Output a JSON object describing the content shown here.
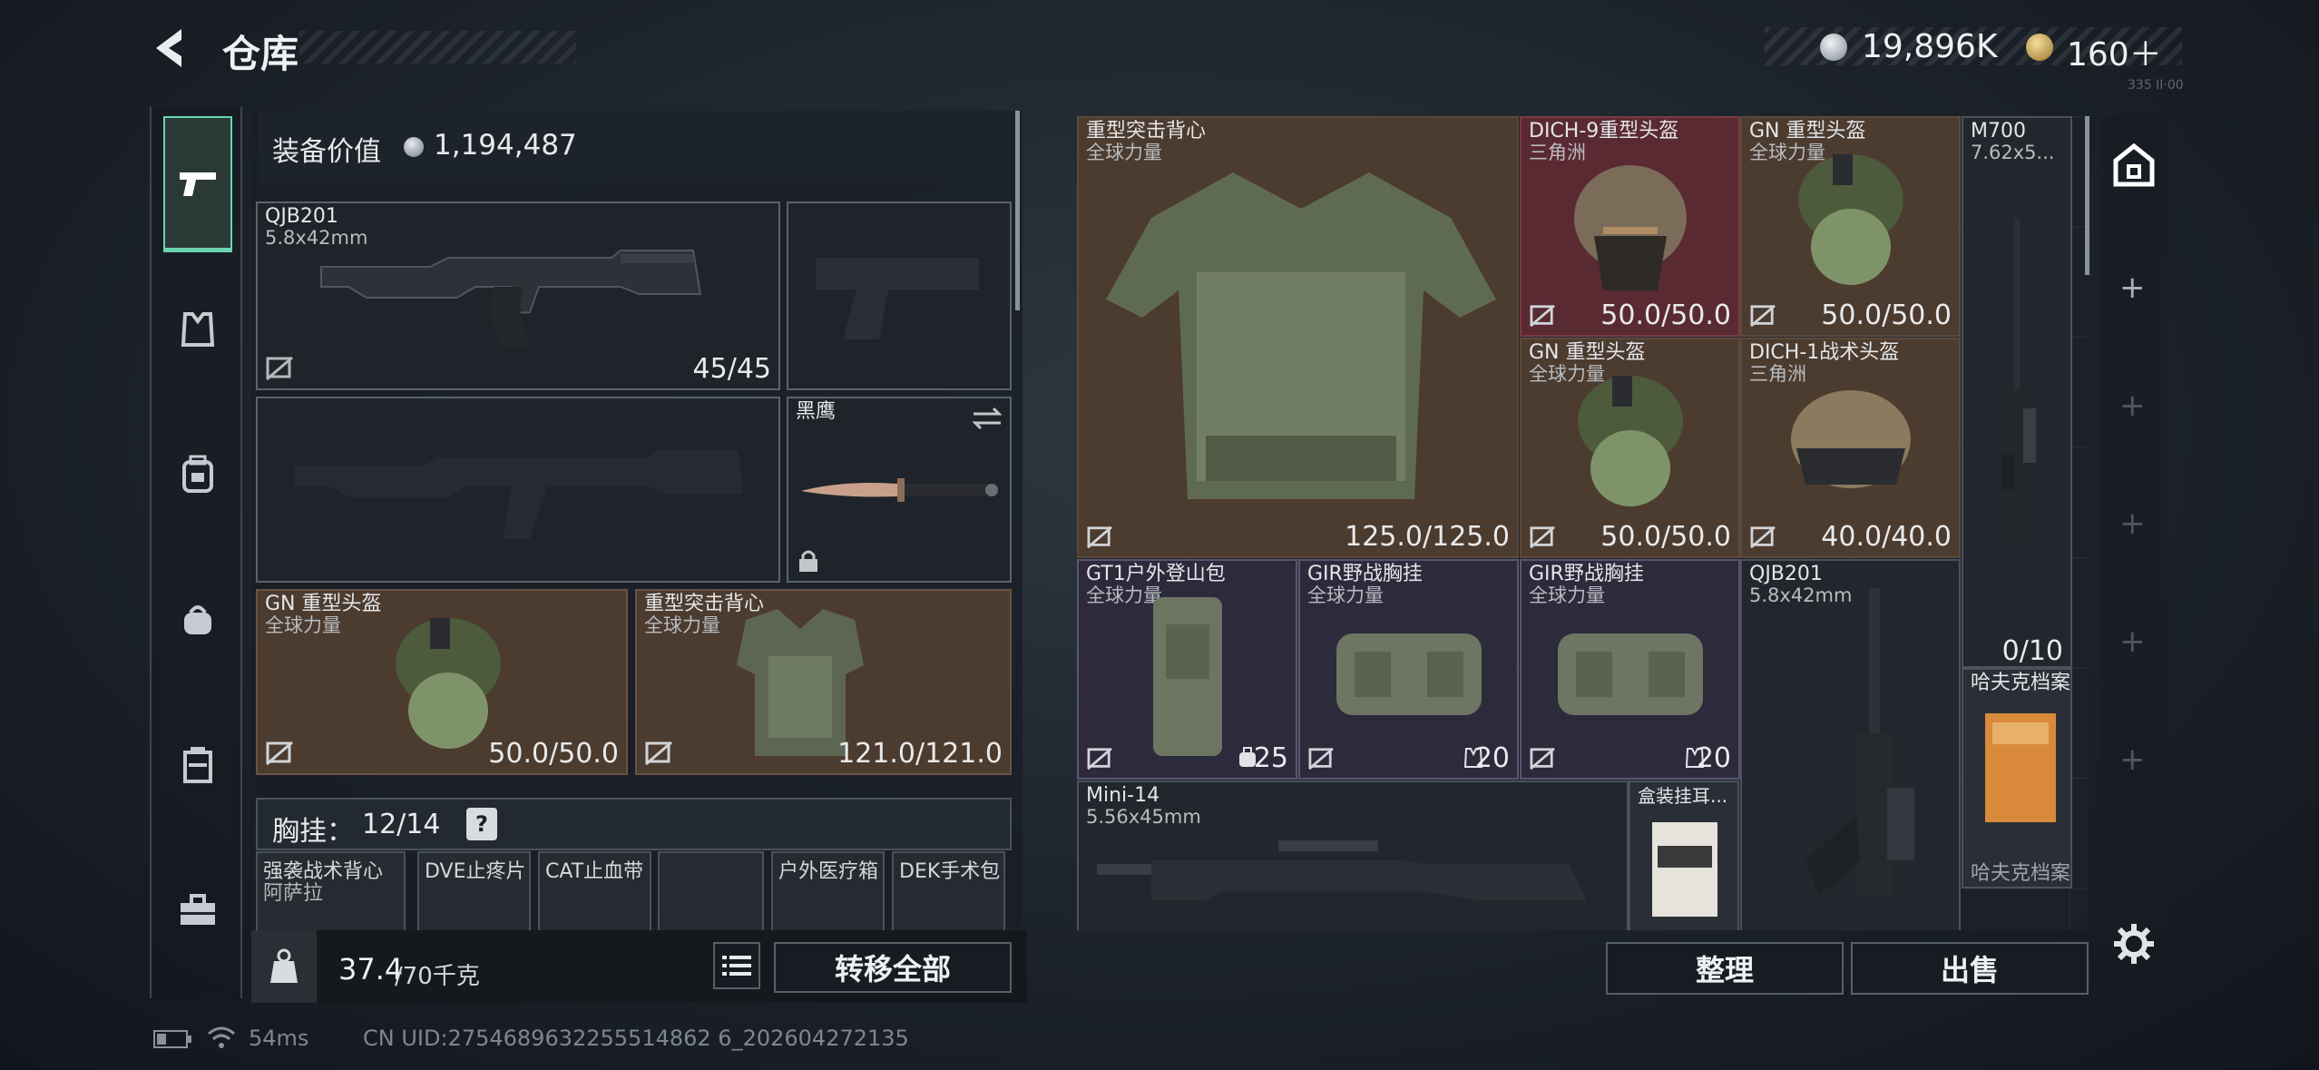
{
  "header": {
    "title": "仓库",
    "currency": [
      {
        "value": "19,896K",
        "color": "#c7ced6"
      },
      {
        "value": "160＋",
        "color": "#c9a65a"
      }
    ],
    "faint_text": "335 II·00"
  },
  "sidebar": {
    "tabs": [
      "weapons",
      "armor",
      "backpack",
      "bag",
      "vest",
      "toolbox"
    ],
    "active": "weapons"
  },
  "left": {
    "equip_label": "装备价值",
    "equip_value": "1,194,487",
    "primary": {
      "name": "QJB201",
      "caliber": "5.8x42mm",
      "durability": "45/45"
    },
    "melee": {
      "name": "黑鹰"
    },
    "helmet": {
      "name": "GN 重型头盔",
      "source": "全球力量",
      "durability": "50.0/50.0"
    },
    "vest": {
      "name": "重型突击背心",
      "source": "全球力量",
      "durability": "121.0/121.0"
    },
    "rig_label": "胸挂：",
    "rig_count": "12/14",
    "rig_help": "?",
    "rig_items": [
      "强袭战术背心",
      "DVE止疼片",
      "CAT止血带",
      "",
      "户外医疗箱",
      "DEK手术包"
    ],
    "rig_sub": "阿萨拉",
    "weight_value": "37.4",
    "weight_max": "/70千克",
    "transfer_all": "转移全部"
  },
  "stash": {
    "items": [
      {
        "name": "重型突击背心",
        "source": "全球力量",
        "value": "125.0/125.0"
      },
      {
        "name": "DICH-9重型头盔",
        "source": "三角洲",
        "value": "50.0/50.0"
      },
      {
        "name": "GN 重型头盔",
        "source": "全球力量",
        "value": "50.0/50.0"
      },
      {
        "name": "M700",
        "source": "7.62x5...",
        "value": "0/10"
      },
      {
        "name": "GN 重型头盔",
        "source": "全球力量",
        "value": "50.0/50.0"
      },
      {
        "name": "DICH-1战术头盔",
        "source": "三角洲",
        "value": "40.0/40.0"
      },
      {
        "name": "GT1户外登山包",
        "source": "全球力量",
        "value": "25"
      },
      {
        "name": "GIR野战胸挂",
        "source": "全球力量",
        "value": "20"
      },
      {
        "name": "GIR野战胸挂",
        "source": "全球力量",
        "value": "20"
      },
      {
        "name": "QJB201",
        "source": "5.8x42mm",
        "value": ""
      },
      {
        "name": "哈夫克档案",
        "source": "",
        "value": ""
      },
      {
        "name": "Mini-14",
        "source": "5.56x45mm",
        "value": ""
      },
      {
        "name": "盒装挂耳...",
        "source": "",
        "value": ""
      },
      {
        "name": "哈夫克档案",
        "source": "",
        "value": ""
      }
    ],
    "sort_button": "整理",
    "sell_button": "出售"
  },
  "status": {
    "ping": "54ms",
    "uid": "CN UID:2754689632255514862 6_202604272135"
  },
  "colors": {
    "accent": "#6ad4b0",
    "brown": "#4c3b2f",
    "purple": "#2d2a3c",
    "red": "#5a2a33"
  }
}
